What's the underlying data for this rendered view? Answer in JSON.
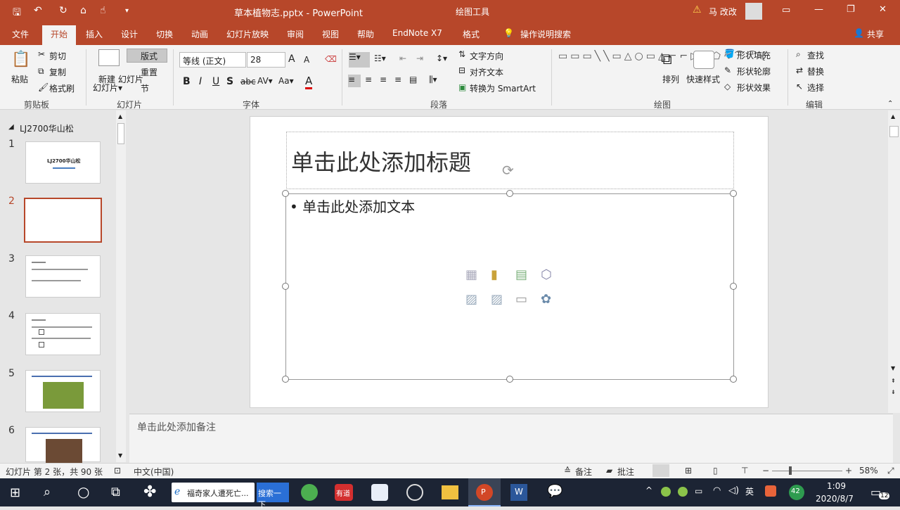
{
  "window": {
    "doc_title": "草本植物志.pptx - PowerPoint",
    "context_tool": "绘图工具",
    "user": "马 改改",
    "minimize": "—",
    "restore": "❐",
    "close": "✕"
  },
  "tabs": [
    "文件",
    "开始",
    "插入",
    "设计",
    "切换",
    "动画",
    "幻灯片放映",
    "审阅",
    "视图",
    "帮助",
    "EndNote X7",
    "格式"
  ],
  "tell_me": "操作说明搜索",
  "share": "共享",
  "ribbon": {
    "clipboard": {
      "paste": "粘贴",
      "cut": "剪切",
      "copy": "复制",
      "format_painter": "格式刷",
      "label": "剪贴板"
    },
    "slides": {
      "new_slide": "新建\n幻灯片",
      "layout": "版式",
      "reset": "重置",
      "section": "节",
      "label": "幻灯片"
    },
    "font": {
      "font_name": "等线 (正文)",
      "font_size": "28",
      "label": "字体"
    },
    "paragraph": {
      "text_direction": "文字方向",
      "align_text": "对齐文本",
      "convert_smartart": "转换为 SmartArt",
      "label": "段落"
    },
    "drawing": {
      "arrange": "排列",
      "quick_styles": "快速样式",
      "shape_fill": "形状填充",
      "shape_outline": "形状轮廓",
      "shape_effects": "形状效果",
      "label": "绘图"
    },
    "editing": {
      "find": "查找",
      "replace": "替换",
      "select": "选择",
      "label": "编辑"
    }
  },
  "thumbs": {
    "section": "LJ2700华山松",
    "numbers": [
      "1",
      "2",
      "3",
      "4",
      "5",
      "6"
    ],
    "slide1_title": "LJ2700华山松"
  },
  "slide": {
    "title_placeholder": "单击此处添加标题",
    "body_placeholder": "• 单击此处添加文本"
  },
  "notes_placeholder": "单击此处添加备注",
  "status": {
    "slide_info": "幻灯片 第 2 张，共 90 张",
    "language": "中文(中国)",
    "notes": "备注",
    "comments": "批注",
    "zoom": "58%"
  },
  "taskbar": {
    "browser_label": "福奇家人遭死亡...",
    "search_btn": "搜索一下",
    "ime": "英",
    "badge": "42",
    "time": "1:09",
    "date": "2020/8/7",
    "notif": "12"
  },
  "colors": {
    "accent": "#b7472a",
    "taskbar": "#1c2434",
    "selected_thumb": "#b7472a"
  }
}
